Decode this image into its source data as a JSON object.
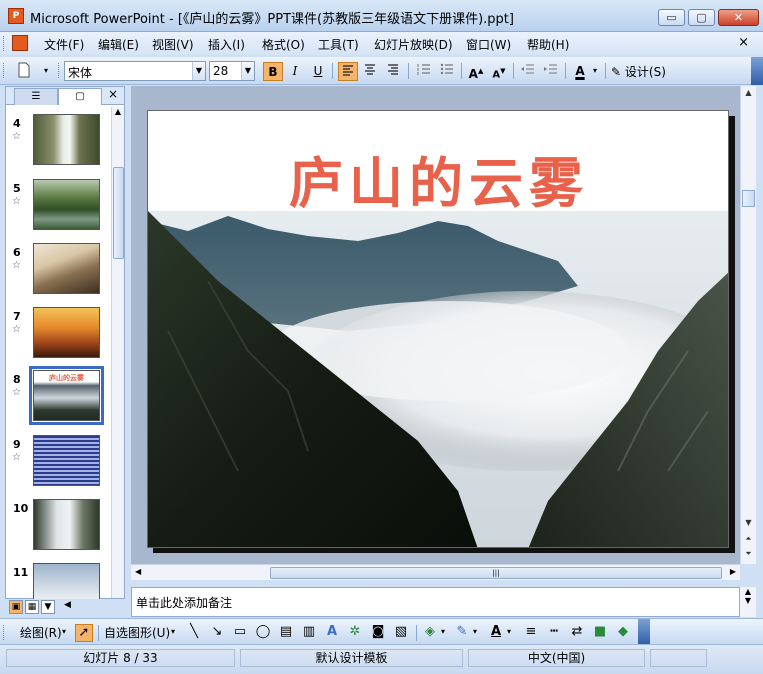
{
  "window": {
    "app_icon": "P",
    "title": "Microsoft PowerPoint - [《庐山的云雾》PPT课件(苏教版三年级语文下册课件).ppt]",
    "minimize": "▭",
    "maximize": "▢",
    "close": "✕"
  },
  "menu": {
    "items": [
      "文件(F)",
      "编辑(E)",
      "视图(V)",
      "插入(I)",
      "格式(O)",
      "工具(T)",
      "幻灯片放映(D)",
      "窗口(W)",
      "帮助(H)"
    ],
    "close": "×"
  },
  "toolbar": {
    "font_name": "宋体",
    "font_size": "28",
    "bold": "B",
    "italic": "I",
    "underline": "U",
    "design": "设计(S)"
  },
  "left_pane": {
    "tab_outline": "☰",
    "tab_slides": "▢",
    "close": "×",
    "thumbnails": [
      {
        "num": "4",
        "star": "☆"
      },
      {
        "num": "5",
        "star": "☆"
      },
      {
        "num": "6",
        "star": "☆"
      },
      {
        "num": "7",
        "star": "☆"
      },
      {
        "num": "8",
        "star": "☆",
        "title": "庐山的云雾"
      },
      {
        "num": "9",
        "star": "☆"
      },
      {
        "num": "10",
        "star": ""
      },
      {
        "num": "11",
        "star": ""
      }
    ]
  },
  "slide": {
    "title": "庐山的云雾"
  },
  "notes": {
    "placeholder": "单击此处添加备注"
  },
  "drawing_toolbar": {
    "draw": "绘图(R)",
    "autoshapes": "自选图形(U)"
  },
  "status": {
    "slide_info": "幻灯片 8 / 33",
    "template": "默认设计模板",
    "language": "中文(中国)"
  },
  "colors": {
    "title_red": "#e8614a",
    "accent_blue": "#3b6bc4"
  }
}
